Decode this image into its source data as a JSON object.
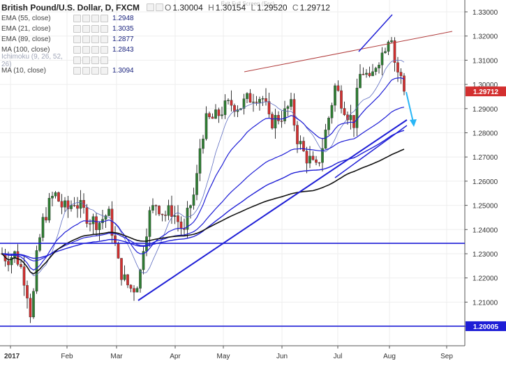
{
  "legend": {
    "symbol": "British Pound/U.S. Dollar, D, FXCM",
    "open_label": "O",
    "open": "1.30004",
    "high_label": "H",
    "high": "1.30154",
    "low_label": "L",
    "low": "1.29520",
    "close_label": "C",
    "close": "1.29712",
    "indicators": [
      {
        "label": "EMA (55, close)",
        "value": "1.2948",
        "color": "#1a237e"
      },
      {
        "label": "EMA (21, close)",
        "value": "1.3035",
        "color": "#1a237e"
      },
      {
        "label": "EMA (89, close)",
        "value": "1.2877",
        "color": "#1a237e"
      },
      {
        "label": "MA (100, close)",
        "value": "1.2843",
        "color": "#1a237e"
      },
      {
        "label": "Ichimoku (9, 26, 52, 26)",
        "value": "",
        "color": "#9aa3b8"
      },
      {
        "label": "MA (10, close)",
        "value": "1.3094",
        "color": "#1a237e"
      }
    ]
  },
  "top_label": "Exit Full Screen (Esc)",
  "chart_data": {
    "type": "candlestick",
    "ylim": [
      1.1953,
      1.3344
    ],
    "y_ticks": [
      "1.33000",
      "1.32000",
      "1.31000",
      "1.30000",
      "1.29000",
      "1.28000",
      "1.27000",
      "1.26000",
      "1.25000",
      "1.24000",
      "1.23000",
      "1.22000",
      "1.21000",
      "1.20000"
    ],
    "x_ticks": [
      "2017",
      "Feb",
      "Mar",
      "Apr",
      "May",
      "Jun",
      "Jul",
      "Aug",
      "Sep"
    ],
    "price_badges": [
      {
        "label": "1.29712",
        "value": 1.29712,
        "color": "#d32f2f"
      },
      {
        "label": "1.20005",
        "value": 1.20005,
        "color": "#1e1ed6"
      }
    ],
    "up_color": "#2e7d32",
    "down_color": "#d32f2f",
    "horizontal_lines": [
      {
        "value": 1.2343,
        "color": "#1e1ed6"
      },
      {
        "value": 1.20005,
        "color": "#1e1ed6"
      }
    ]
  }
}
